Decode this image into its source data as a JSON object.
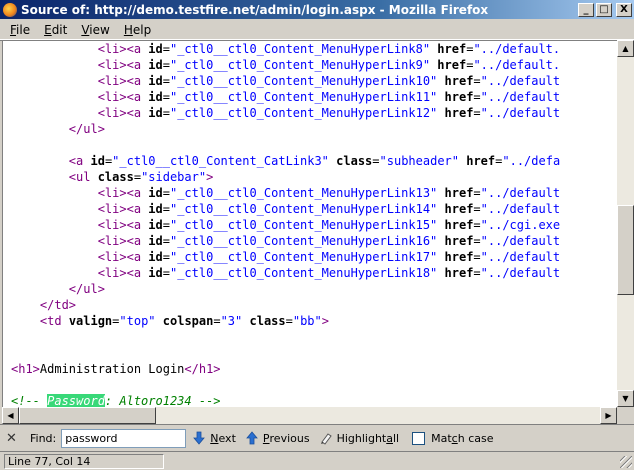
{
  "window": {
    "title": "Source of: http://demo.testfire.net/admin/login.aspx - Mozilla Firefox",
    "minimize": "_",
    "maximize": "□",
    "close": "X"
  },
  "menu": [
    {
      "key": "F",
      "rest": "ile"
    },
    {
      "key": "E",
      "rest": "dit"
    },
    {
      "key": "V",
      "rest": "iew"
    },
    {
      "key": "H",
      "rest": "elp"
    }
  ],
  "source_lines": [
    [
      [
        "txt",
        "            "
      ],
      [
        "tag",
        "<li><a "
      ],
      [
        "attr",
        "id"
      ],
      [
        "txt",
        "="
      ],
      [
        "val",
        "\"_ctl0__ctl0_Content_MenuHyperLink8\""
      ],
      [
        "txt",
        " "
      ],
      [
        "attr",
        "href"
      ],
      [
        "txt",
        "="
      ],
      [
        "val",
        "\"../default."
      ]
    ],
    [
      [
        "txt",
        "            "
      ],
      [
        "tag",
        "<li><a "
      ],
      [
        "attr",
        "id"
      ],
      [
        "txt",
        "="
      ],
      [
        "val",
        "\"_ctl0__ctl0_Content_MenuHyperLink9\""
      ],
      [
        "txt",
        " "
      ],
      [
        "attr",
        "href"
      ],
      [
        "txt",
        "="
      ],
      [
        "val",
        "\"../default."
      ]
    ],
    [
      [
        "txt",
        "            "
      ],
      [
        "tag",
        "<li><a "
      ],
      [
        "attr",
        "id"
      ],
      [
        "txt",
        "="
      ],
      [
        "val",
        "\"_ctl0__ctl0_Content_MenuHyperLink10\""
      ],
      [
        "txt",
        " "
      ],
      [
        "attr",
        "href"
      ],
      [
        "txt",
        "="
      ],
      [
        "val",
        "\"../default"
      ]
    ],
    [
      [
        "txt",
        "            "
      ],
      [
        "tag",
        "<li><a "
      ],
      [
        "attr",
        "id"
      ],
      [
        "txt",
        "="
      ],
      [
        "val",
        "\"_ctl0__ctl0_Content_MenuHyperLink11\""
      ],
      [
        "txt",
        " "
      ],
      [
        "attr",
        "href"
      ],
      [
        "txt",
        "="
      ],
      [
        "val",
        "\"../default"
      ]
    ],
    [
      [
        "txt",
        "            "
      ],
      [
        "tag",
        "<li><a "
      ],
      [
        "attr",
        "id"
      ],
      [
        "txt",
        "="
      ],
      [
        "val",
        "\"_ctl0__ctl0_Content_MenuHyperLink12\""
      ],
      [
        "txt",
        " "
      ],
      [
        "attr",
        "href"
      ],
      [
        "txt",
        "="
      ],
      [
        "val",
        "\"../default"
      ]
    ],
    [
      [
        "txt",
        "        "
      ],
      [
        "tag",
        "</ul>"
      ]
    ],
    [
      [
        "txt",
        ""
      ]
    ],
    [
      [
        "txt",
        "        "
      ],
      [
        "tag",
        "<a "
      ],
      [
        "attr",
        "id"
      ],
      [
        "txt",
        "="
      ],
      [
        "val",
        "\"_ctl0__ctl0_Content_CatLink3\""
      ],
      [
        "txt",
        " "
      ],
      [
        "attr",
        "class"
      ],
      [
        "txt",
        "="
      ],
      [
        "val",
        "\"subheader\""
      ],
      [
        "txt",
        " "
      ],
      [
        "attr",
        "href"
      ],
      [
        "txt",
        "="
      ],
      [
        "val",
        "\"../defa"
      ]
    ],
    [
      [
        "txt",
        "        "
      ],
      [
        "tag",
        "<ul "
      ],
      [
        "attr",
        "class"
      ],
      [
        "txt",
        "="
      ],
      [
        "val",
        "\"sidebar\""
      ],
      [
        "tag",
        ">"
      ]
    ],
    [
      [
        "txt",
        "            "
      ],
      [
        "tag",
        "<li><a "
      ],
      [
        "attr",
        "id"
      ],
      [
        "txt",
        "="
      ],
      [
        "val",
        "\"_ctl0__ctl0_Content_MenuHyperLink13\""
      ],
      [
        "txt",
        " "
      ],
      [
        "attr",
        "href"
      ],
      [
        "txt",
        "="
      ],
      [
        "val",
        "\"../default"
      ]
    ],
    [
      [
        "txt",
        "            "
      ],
      [
        "tag",
        "<li><a "
      ],
      [
        "attr",
        "id"
      ],
      [
        "txt",
        "="
      ],
      [
        "val",
        "\"_ctl0__ctl0_Content_MenuHyperLink14\""
      ],
      [
        "txt",
        " "
      ],
      [
        "attr",
        "href"
      ],
      [
        "txt",
        "="
      ],
      [
        "val",
        "\"../default"
      ]
    ],
    [
      [
        "txt",
        "            "
      ],
      [
        "tag",
        "<li><a "
      ],
      [
        "attr",
        "id"
      ],
      [
        "txt",
        "="
      ],
      [
        "val",
        "\"_ctl0__ctl0_Content_MenuHyperLink15\""
      ],
      [
        "txt",
        " "
      ],
      [
        "attr",
        "href"
      ],
      [
        "txt",
        "="
      ],
      [
        "val",
        "\"../cgi.exe"
      ]
    ],
    [
      [
        "txt",
        "            "
      ],
      [
        "tag",
        "<li><a "
      ],
      [
        "attr",
        "id"
      ],
      [
        "txt",
        "="
      ],
      [
        "val",
        "\"_ctl0__ctl0_Content_MenuHyperLink16\""
      ],
      [
        "txt",
        " "
      ],
      [
        "attr",
        "href"
      ],
      [
        "txt",
        "="
      ],
      [
        "val",
        "\"../default"
      ]
    ],
    [
      [
        "txt",
        "            "
      ],
      [
        "tag",
        "<li><a "
      ],
      [
        "attr",
        "id"
      ],
      [
        "txt",
        "="
      ],
      [
        "val",
        "\"_ctl0__ctl0_Content_MenuHyperLink17\""
      ],
      [
        "txt",
        " "
      ],
      [
        "attr",
        "href"
      ],
      [
        "txt",
        "="
      ],
      [
        "val",
        "\"../default"
      ]
    ],
    [
      [
        "txt",
        "            "
      ],
      [
        "tag",
        "<li><a "
      ],
      [
        "attr",
        "id"
      ],
      [
        "txt",
        "="
      ],
      [
        "val",
        "\"_ctl0__ctl0_Content_MenuHyperLink18\""
      ],
      [
        "txt",
        " "
      ],
      [
        "attr",
        "href"
      ],
      [
        "txt",
        "="
      ],
      [
        "val",
        "\"../default"
      ]
    ],
    [
      [
        "txt",
        "        "
      ],
      [
        "tag",
        "</ul>"
      ]
    ],
    [
      [
        "txt",
        "    "
      ],
      [
        "tag",
        "</td>"
      ]
    ],
    [
      [
        "txt",
        "    "
      ],
      [
        "tag",
        "<td "
      ],
      [
        "attr",
        "valign"
      ],
      [
        "txt",
        "="
      ],
      [
        "val",
        "\"top\""
      ],
      [
        "txt",
        " "
      ],
      [
        "attr",
        "colspan"
      ],
      [
        "txt",
        "="
      ],
      [
        "val",
        "\"3\""
      ],
      [
        "txt",
        " "
      ],
      [
        "attr",
        "class"
      ],
      [
        "txt",
        "="
      ],
      [
        "val",
        "\"bb\""
      ],
      [
        "tag",
        ">"
      ]
    ],
    [
      [
        "txt",
        ""
      ]
    ],
    [
      [
        "txt",
        ""
      ]
    ],
    [
      [
        "tag",
        "<h1>"
      ],
      [
        "txt",
        "Administration Login"
      ],
      [
        "tag",
        "</h1>"
      ]
    ],
    [
      [
        "txt",
        ""
      ]
    ],
    [
      [
        "cmt",
        "<!-- "
      ],
      [
        "hl",
        "Password"
      ],
      [
        "cmt",
        ": Altoro1234 -->"
      ]
    ]
  ],
  "findbar": {
    "close": "✕",
    "label": "Find:",
    "query": "password",
    "next_key": "N",
    "next_rest": "ext",
    "previous_key": "P",
    "previous_rest": "revious",
    "highlight_pre": "Highlight ",
    "highlight_key": "a",
    "highlight_rest": "ll",
    "match_pre": "Mat",
    "match_key": "c",
    "match_rest": "h case"
  },
  "status": {
    "position": "Line 77, Col 14"
  }
}
